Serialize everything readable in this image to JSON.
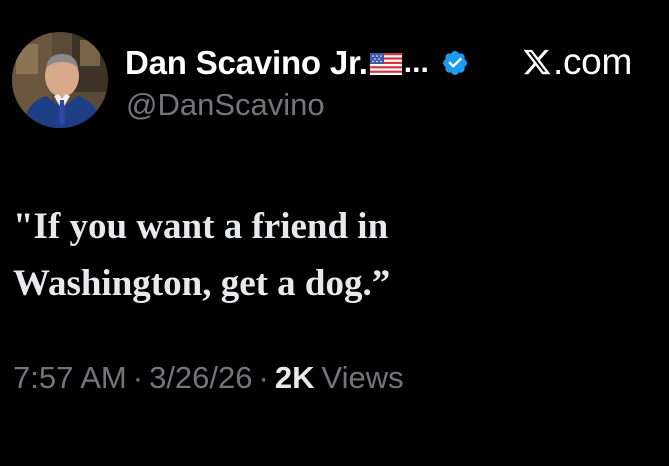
{
  "author": {
    "display_name": "Dan Scavino Jr.",
    "name_suffix": "...",
    "handle": "@DanScavino",
    "verified_icon": "verified-badge-icon",
    "flag_icon": "us-flag-icon",
    "avatar": "profile-photo"
  },
  "site": {
    "logo_icon": "x-logo-icon",
    "domain_suffix": ".com"
  },
  "tweet": {
    "line_1": "\"If you want a friend in",
    "line_2": "Washington, get a dog.”"
  },
  "meta": {
    "time": "7:57 AM",
    "separator": "·",
    "date": "3/26/26",
    "views_count": "2K",
    "views_label": "Views"
  },
  "colors": {
    "background": "#000000",
    "primary_text": "#e7e9ea",
    "secondary_text": "#71767b",
    "verified_blue": "#1d9bf0"
  }
}
